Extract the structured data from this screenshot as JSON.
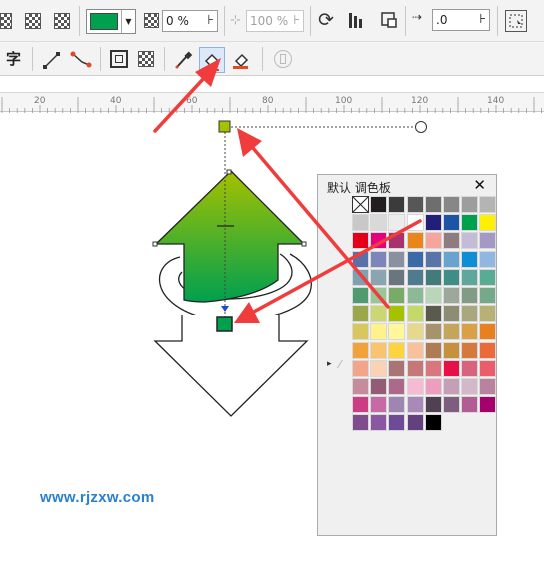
{
  "toolbar_top": {
    "fill_color": "#00a04f",
    "opacity_value": "0 %",
    "scale_value": "100 %",
    "nudge_value": ".0"
  },
  "toolbar_second": {
    "text_tool_label": "字"
  },
  "ruler": {
    "ticks": [
      "20",
      "40",
      "60",
      "80",
      "100",
      "120",
      "140"
    ]
  },
  "palette": {
    "title": "默认 调色板",
    "close_label": "✕",
    "expand_label": "▸",
    "rows": [
      [
        "none",
        "#221e1f",
        "#3b3b3b",
        "#575757",
        "#6e6e6e",
        "#878787",
        "#9d9d9d",
        "#b4b4b4"
      ],
      [
        "#c8c8c8",
        "#d9d9d9",
        "#ececec",
        "#ffffff",
        "#231f78",
        "#1d55a6",
        "#00a04f",
        "#ffef00"
      ],
      [
        "#e2001a",
        "#e4007f",
        "#a8326e",
        "#e8861b",
        "#f6a59c",
        "#8e7c81",
        "#c3bcd6",
        "#a399c4"
      ],
      [
        "#5b6fa8",
        "#7b86b9",
        "#8990a0",
        "#3c6aa8",
        "#5a74a9",
        "#69a3cf",
        "#0e8fd3",
        "#8fb7df"
      ],
      [
        "#7fa2b2",
        "#8aa5b0",
        "#69767d",
        "#4d7c8f",
        "#437a7a",
        "#3e8d86",
        "#5fa79d",
        "#58ac93"
      ],
      [
        "#4e9b6f",
        "#98c696",
        "#79aa67",
        "#8cb996",
        "#b9d6b9",
        "#9da89a",
        "#829b84",
        "#74a989"
      ],
      [
        "#9aa84b",
        "#cdd674",
        "#a5c100",
        "#c5d96a",
        "#5a5a4d",
        "#8d8d75",
        "#a9a77e",
        "#b8b174"
      ],
      [
        "#d8c75e",
        "#fdf28b",
        "#fff799",
        "#e6d98f",
        "#a6926b",
        "#c3a55c",
        "#d9a04a",
        "#e8801f"
      ],
      [
        "#f1a23a",
        "#f8c470",
        "#fdd43f",
        "#f8c19c",
        "#ad7c55",
        "#c6903d",
        "#d47a3c",
        "#ea6a3a"
      ],
      [
        "#f3a58b",
        "#fbd2b5",
        "#a97475",
        "#c67778",
        "#d9777f",
        "#e60f47",
        "#d8637e",
        "#ec5d6c"
      ],
      [
        "#c58c9b",
        "#935c74",
        "#ac6a8a",
        "#f5bcd1",
        "#ee9dbd",
        "#c59fb8",
        "#d2b8c8",
        "#b9829f"
      ],
      [
        "#cc3d84",
        "#c56aa2",
        "#9e86b3",
        "#a889b8",
        "#4f4150",
        "#7e5e7f",
        "#b15c92",
        "#a5006c"
      ],
      [
        "#7f4d8c",
        "#8a58a1",
        "#6e4a98",
        "#63417f",
        "#000000"
      ]
    ]
  },
  "watermark": "www.rjzxw.com"
}
